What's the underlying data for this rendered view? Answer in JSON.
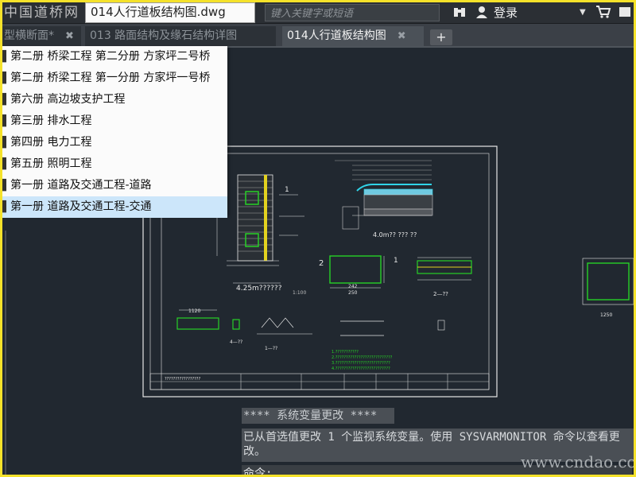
{
  "app": {
    "watermark_top": "中国道桥网",
    "document_title": "014人行道板结构图.dwg",
    "search_placeholder": "键入关键字或短语",
    "login_label": "登录",
    "watermark_bottom": "www.cndao.com"
  },
  "tabs": [
    {
      "label": "型横断面*",
      "active": false
    },
    {
      "label": "013 路面结构及缘石结构详图",
      "active": false
    },
    {
      "label": "014人行道板结构图",
      "active": true
    }
  ],
  "menu": {
    "items": [
      {
        "label": "第二册 桥梁工程 第二分册 方家坪二号桥",
        "selected": false
      },
      {
        "label": "第二册 桥梁工程 第一分册 方家坪一号桥",
        "selected": false
      },
      {
        "label": "第六册 高边坡支护工程",
        "selected": false
      },
      {
        "label": "第三册 排水工程",
        "selected": false
      },
      {
        "label": "第四册 电力工程",
        "selected": false
      },
      {
        "label": "第五册 照明工程",
        "selected": false
      },
      {
        "label": "第一册 道路及交通工程-道路",
        "selected": false
      },
      {
        "label": "第一册 道路及交通工程-交通",
        "selected": true
      }
    ],
    "icon": "folder-icon"
  },
  "drawing": {
    "label_main": "4.25m??????",
    "label_note": "1:100",
    "label_deck": "4.0m?? ??? ??",
    "label_section1": "2—??",
    "label_section2": "4—??",
    "label_section3": "1—??",
    "notes": [
      "1.???????????",
      "2.???????????????????????????",
      "3.??????????????????????????",
      "4.??????????????????????????"
    ],
    "title_block_text": "?????????????????",
    "dim_243": "242",
    "dim_250": "250",
    "dim_1120": "1120",
    "dim_1250": "1250"
  },
  "command": {
    "line1": "**** 系统变量更改 ****",
    "line2": "已从首选值更改 1 个监视系统变量。使用 SYSVARMONITOR 命令以查看更改。",
    "prompt": "命令:"
  },
  "colors": {
    "accent_frame": "#f5e22a",
    "canvas_bg": "#212830",
    "menu_selected": "#cce6fa"
  }
}
